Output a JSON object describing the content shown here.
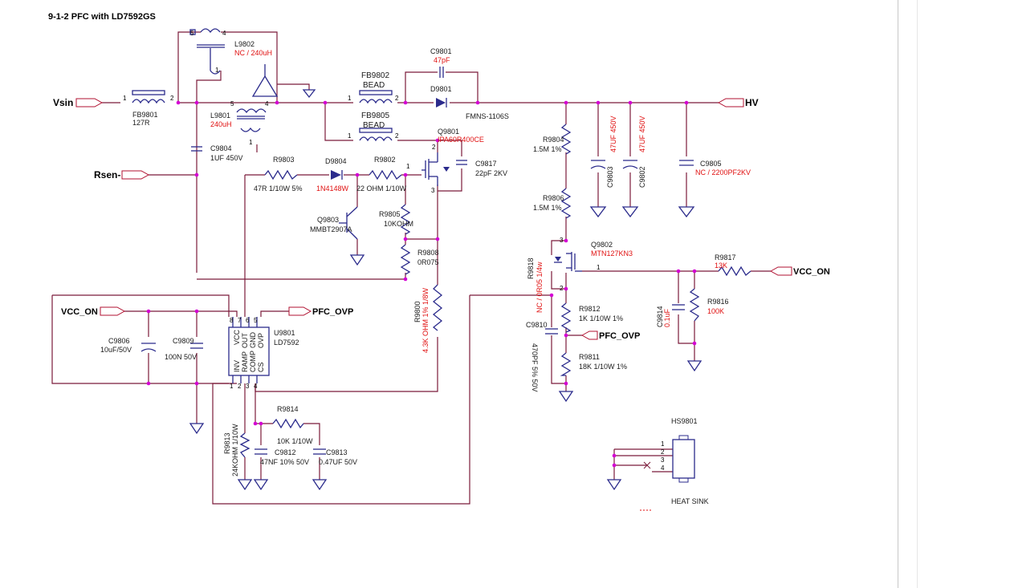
{
  "title": "9-1-2 PFC with LD7592GS",
  "ports": {
    "vsin": "Vsin",
    "hv": "HV",
    "rsen": "Rsen-",
    "vcc_on_left": "VCC_ON",
    "vcc_on_right": "VCC_ON",
    "pfc_ovp_top": "PFC_OVP",
    "pfc_ovp_right": "PFC_OVP"
  },
  "comp": {
    "l9802": {
      "ref": "L9802",
      "val": "NC / 240uH"
    },
    "fb9801": {
      "ref": "FB9801",
      "val": "127R"
    },
    "l9801": {
      "ref": "L9801",
      "val": "240uH"
    },
    "c9804": {
      "ref": "C9804",
      "val": "1UF 450V"
    },
    "fb9802": {
      "ref": "FB9802",
      "val": "BEAD"
    },
    "fb9805": {
      "ref": "FB9805",
      "val": "BEAD"
    },
    "c9801": {
      "ref": "C9801",
      "val": "47pF"
    },
    "d9801": {
      "ref": "D9801",
      "val": "FMNS-1106S"
    },
    "q9801": {
      "ref": "Q9801",
      "val": "IPA60R400CE"
    },
    "c9817": {
      "ref": "C9817",
      "val": "22pF 2KV"
    },
    "r9803": {
      "ref": "R9803",
      "val": "47R 1/10W 5%"
    },
    "d9804": {
      "ref": "D9804",
      "val": "1N4148W"
    },
    "r9802": {
      "ref": "R9802",
      "val": "22 OHM 1/10W"
    },
    "q9803": {
      "ref": "Q9803",
      "val": "MMBT2907A"
    },
    "r9805": {
      "ref": "R9805",
      "val": "10KOHM"
    },
    "r9808": {
      "ref": "R9808",
      "val": "0R075"
    },
    "r9804": {
      "ref": "R9804",
      "val": "1.5M 1%"
    },
    "r9806": {
      "ref": "R9806",
      "val": "1.5M 1%"
    },
    "c9803": {
      "ref": "C9803",
      "val": "47UF 450V"
    },
    "c9802": {
      "ref": "C9802",
      "val": "47UF 450V"
    },
    "c9805": {
      "ref": "C9805",
      "val": "NC / 2200PF2KV"
    },
    "q9802": {
      "ref": "Q9802",
      "val": "MTN127KN3"
    },
    "r9818": {
      "ref": "R9818",
      "val": "NC / 0R05 1/4w"
    },
    "r9817": {
      "ref": "R9817",
      "val": "13K"
    },
    "r9816": {
      "ref": "R9816",
      "val": "100K"
    },
    "c9814": {
      "ref": "C9814",
      "val": "0.1uF"
    },
    "r9812": {
      "ref": "R9812",
      "val": "1K 1/10W 1%"
    },
    "c9810": {
      "ref": "C9810",
      "val": "470PF 5% 50V"
    },
    "r9811": {
      "ref": "R9811",
      "val": "18K 1/10W 1%"
    },
    "c9806": {
      "ref": "C9806",
      "val": "10uF/50V"
    },
    "c9809": {
      "ref": "C9809",
      "val": "100N 50V"
    },
    "u9801": {
      "ref": "U9801",
      "val": "LD7592"
    },
    "r9800": {
      "ref": "R9800",
      "val": "4.3K OHM 1% 1/8W"
    },
    "r9814": {
      "ref": "R9814",
      "val": "10K 1/10W"
    },
    "r9813": {
      "ref": "R9813",
      "val": "24KOHM 1/10W"
    },
    "c9812": {
      "ref": "C9812",
      "val": "47NF 10% 50V"
    },
    "c9813": {
      "ref": "C9813",
      "val": "0.47UF 50V"
    },
    "hs9801": {
      "ref": "HS9801",
      "val": "HEAT SINK"
    }
  },
  "ic_pins": [
    "INV",
    "VCC",
    "RAMP",
    "OUT",
    "COMP",
    "GND",
    "OVP",
    "CS"
  ],
  "hs_pins": [
    "1",
    "2",
    "3",
    "4"
  ],
  "colors": {
    "wire": "#7b1a3a",
    "component": "#2b2b8c",
    "junction": "#d400d4",
    "value_red": "#e01010"
  }
}
